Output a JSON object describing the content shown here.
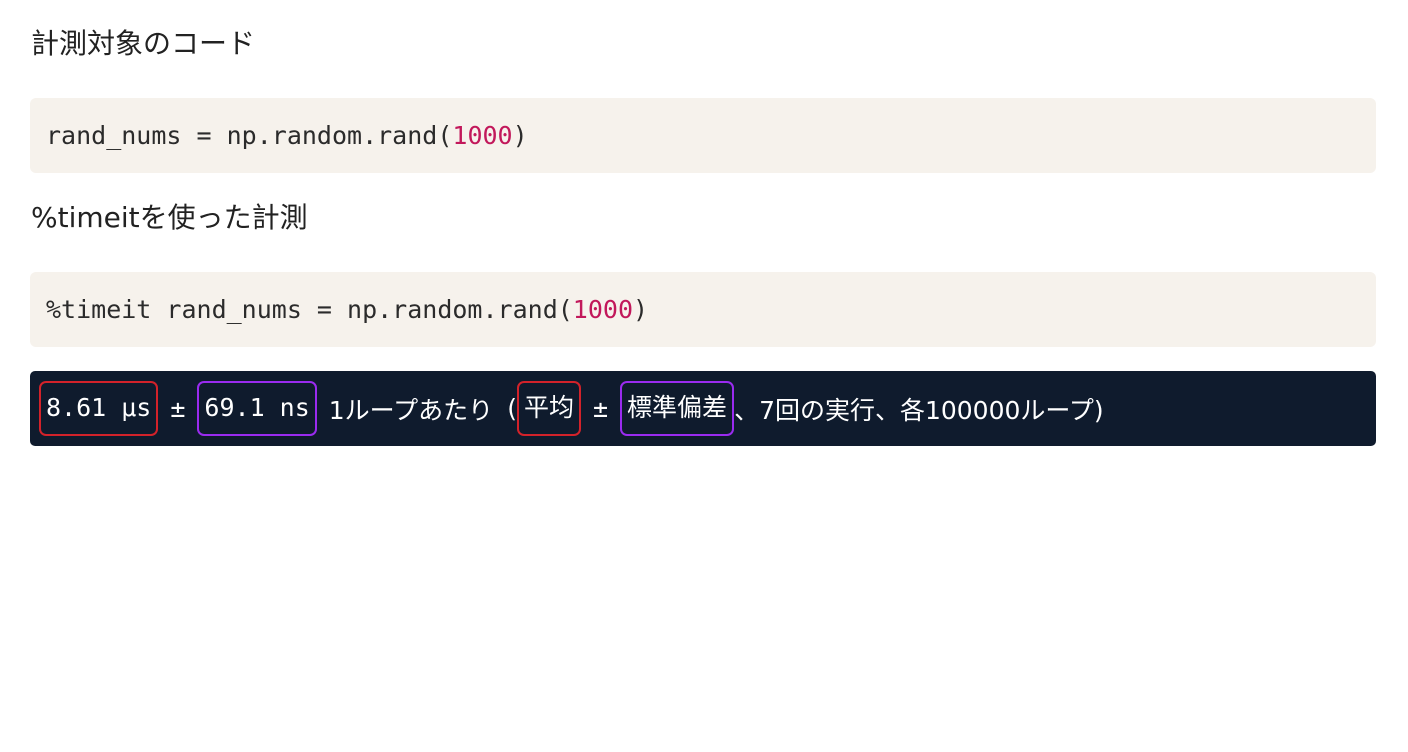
{
  "headings": {
    "target_code": "計測対象のコード",
    "timeit_measure": "%timeitを使った計測"
  },
  "code_blocks": {
    "first": {
      "prefix": "rand_nums = np.random.rand(",
      "number": "1000",
      "suffix": ")"
    },
    "second": {
      "prefix": "%timeit rand_nums = np.random.rand(",
      "number": "1000",
      "suffix": ")"
    }
  },
  "output": {
    "mean_value": "8.61 μs",
    "plus_minus_1": "±",
    "std_value": "69.1 ns",
    "per_loop_text": "1ループあたり",
    "open_paren": "(",
    "mean_label": "平均",
    "plus_minus_2": "±",
    "std_label": "標準偏差",
    "run_info": "、7回の実行、各100000ループ)"
  },
  "colors": {
    "code_background": "#f6f2ec",
    "output_background": "#0f1b2d",
    "number_highlight": "#c2185b",
    "mean_box": "#d3222a",
    "std_box": "#9a2bf0"
  }
}
